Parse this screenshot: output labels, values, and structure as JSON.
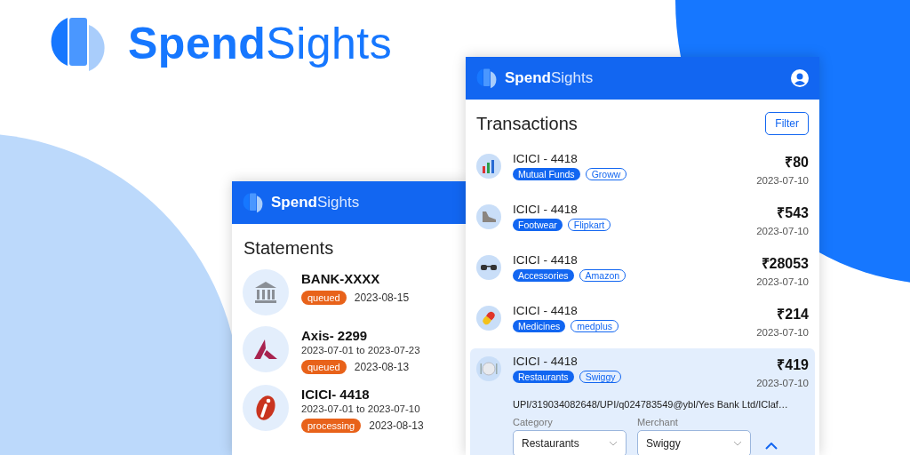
{
  "brand": {
    "name": "**Spend**Sights"
  },
  "statements_window": {
    "app_name": "**Spend**Sights",
    "title": "Statements",
    "items": [
      {
        "kind": "bank",
        "name": "BANK-XXXX",
        "status": "queued",
        "date": "2023-08-15"
      },
      {
        "kind": "triangle",
        "name": "Axis- 2299",
        "range": "2023-07-01 to 2023-07-23",
        "status": "queued",
        "date": "2023-08-13"
      },
      {
        "kind": "oval",
        "name": "ICICI- 4418",
        "range": "2023-07-01 to 2023-07-10",
        "status": "processing",
        "date": "2023-08-13"
      }
    ]
  },
  "transactions_window": {
    "app_name": "**Spend**Sights",
    "title": "Transactions",
    "filter_button": "Filter",
    "items": [
      {
        "kind": "chart",
        "account": "ICICI - 4418",
        "category": "Mutual Funds",
        "merchant": "Groww",
        "amount": "₹80",
        "date": "2023-07-10",
        "expanded": false
      },
      {
        "kind": "shoe",
        "account": "ICICI - 4418",
        "category": "Footwear",
        "merchant": "Flipkart",
        "amount": "₹543",
        "date": "2023-07-10",
        "expanded": false
      },
      {
        "kind": "glasses",
        "account": "ICICI - 4418",
        "category": "Accessories",
        "merchant": "Amazon",
        "amount": "₹28053",
        "date": "2023-07-10",
        "expanded": false
      },
      {
        "kind": "pill",
        "account": "ICICI - 4418",
        "category": "Medicines",
        "merchant": "medplus",
        "amount": "₹214",
        "date": "2023-07-10",
        "expanded": false
      },
      {
        "kind": "plate",
        "account": "ICICI - 4418",
        "category": "Restaurants",
        "merchant": "Swiggy",
        "amount": "₹419",
        "date": "2023-07-10",
        "expanded": true,
        "details": {
          "description": "UPI/319034082648/UPI/q024783549@ybl/Yes Bank Ltd/IClaf…",
          "category_label": "Category",
          "category_value": "Restaurants",
          "merchant_label": "Merchant",
          "merchant_value": "Swiggy"
        }
      }
    ]
  }
}
